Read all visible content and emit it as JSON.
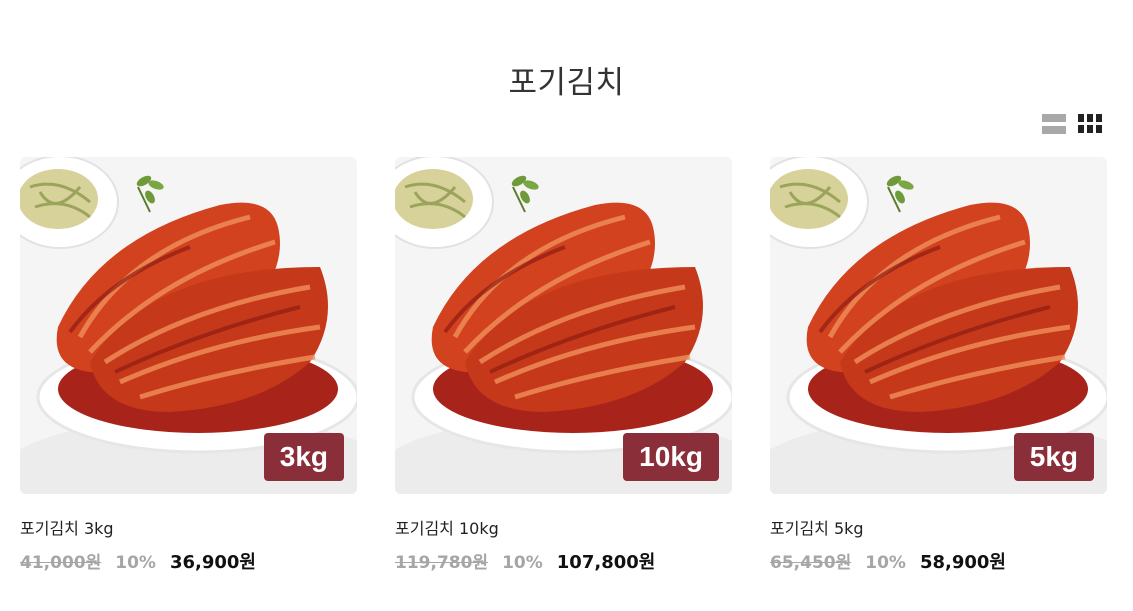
{
  "page": {
    "title": "포기김치"
  },
  "view_toggle": {
    "list_icon": "list-view-icon",
    "grid_icon": "grid-view-icon",
    "active": "grid"
  },
  "colors": {
    "badge": "#8a2f3a",
    "muted_price": "#a6a6a6",
    "sale_price": "#111111"
  },
  "products": [
    {
      "badge": "3kg",
      "name": "포기김치 3kg",
      "original_price": "41,000원",
      "discount": "10%",
      "sale_price": "36,900원"
    },
    {
      "badge": "10kg",
      "name": "포기김치 10kg",
      "original_price": "119,780원",
      "discount": "10%",
      "sale_price": "107,800원"
    },
    {
      "badge": "5kg",
      "name": "포기김치 5kg",
      "original_price": "65,450원",
      "discount": "10%",
      "sale_price": "58,900원"
    }
  ]
}
